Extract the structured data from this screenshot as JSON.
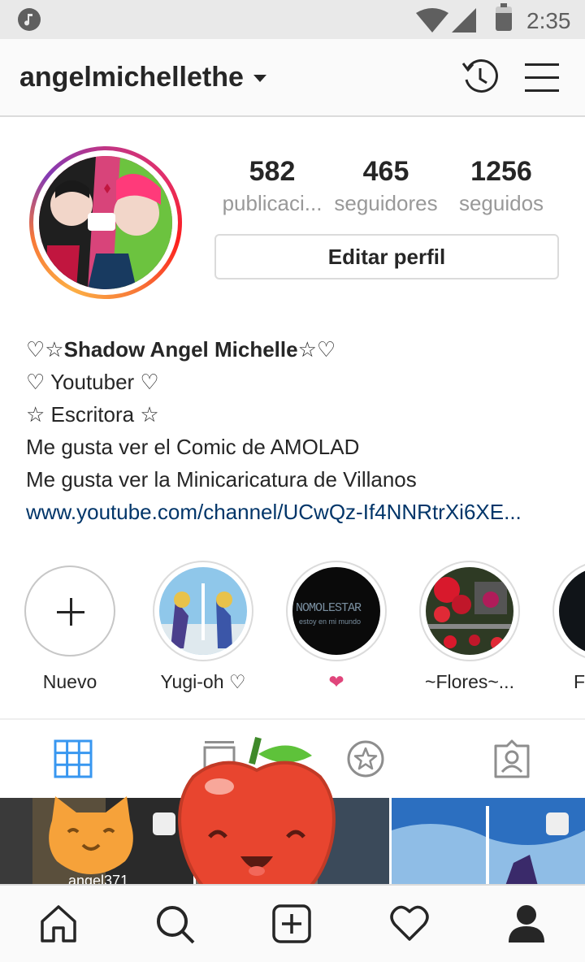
{
  "status_bar": {
    "time": "2:35",
    "icons": [
      "music-icon",
      "wifi-icon",
      "signal-icon",
      "battery-icon"
    ]
  },
  "header": {
    "username": "angelmichellethe",
    "icons": [
      "chevron-down-icon",
      "history-icon",
      "menu-icon"
    ]
  },
  "stats": [
    {
      "value": "582",
      "label": "publicaci..."
    },
    {
      "value": "465",
      "label": "seguidores"
    },
    {
      "value": "1256",
      "label": "seguidos"
    }
  ],
  "edit_button": "Editar perfil",
  "bio": {
    "name": "♡☆Shadow Angel Michelle☆♡",
    "lines": [
      "♡ Youtuber ♡",
      "☆ Escritora ☆",
      "Me gusta ver el Comic de AMOLAD",
      "Me gusta ver la Minicaricatura de Villanos"
    ],
    "link": "www.youtube.com/channel/UCwQz-If4NNRtrXi6XE..."
  },
  "highlights": [
    {
      "label": "Nuevo"
    },
    {
      "label": "Yugi-oh ♡"
    },
    {
      "label": "❤",
      "image_text": "NOMOLESTAR",
      "image_subtext": "estoy en mi mundo"
    },
    {
      "label": "~Flores~..."
    },
    {
      "label": "F"
    }
  ],
  "grid_tiles": [
    {
      "caption": "angel371"
    }
  ],
  "tabs": [
    "grid-icon",
    "feed-icon",
    "tagged-star-icon",
    "tagged-photos-icon"
  ],
  "bottom_nav": [
    "home-icon",
    "search-icon",
    "add-icon",
    "heart-icon",
    "profile-icon"
  ],
  "colors": {
    "accent": "#3897f0",
    "link": "#003569",
    "muted_text": "#999999",
    "heart": "#e0457b"
  }
}
